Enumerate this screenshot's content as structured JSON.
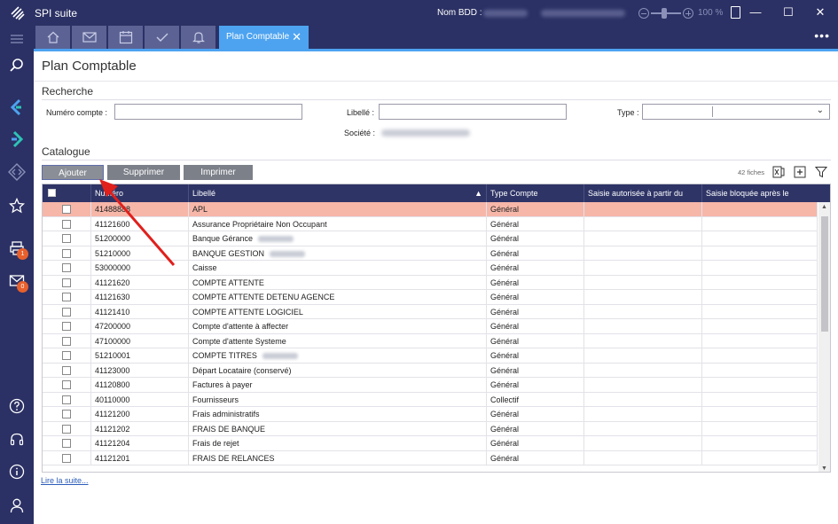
{
  "titlebar": {
    "app_name": "SPI suite",
    "db_label": "Nom BDD :",
    "zoom": "100 %",
    "minimize": "—",
    "maximize": "☐",
    "close": "✕"
  },
  "sidebar": {
    "badges": {
      "printer": "1",
      "mail": "0"
    }
  },
  "tabs": {
    "active_label": "Plan Comptable",
    "close_glyph": "✕",
    "more": "•••"
  },
  "page": {
    "title": "Plan Comptable"
  },
  "search": {
    "section_title": "Recherche",
    "numero_label": "Numéro compte :",
    "numero_value": "",
    "libelle_label": "Libellé :",
    "libelle_value": "",
    "type_label": "Type :",
    "type_value": "",
    "societe_label": "Société :"
  },
  "catalogue": {
    "section_title": "Catalogue",
    "buttons": {
      "add": "Ajouter",
      "delete": "Supprimer",
      "print": "Imprimer"
    },
    "count_text": "42 fiches",
    "columns": [
      "Numéro",
      "Libellé",
      "Type Compte",
      "Saisie autorisée à partir du",
      "Saisie bloquée après le"
    ],
    "sort_indicator": "▲",
    "rows": [
      {
        "numero": "41488888",
        "libelle": "APL",
        "type": "Général",
        "selected": true
      },
      {
        "numero": "41121600",
        "libelle": "Assurance Propriétaire Non Occupant",
        "type": "Général"
      },
      {
        "numero": "51200000",
        "libelle": "Banque Gérance",
        "type": "Général",
        "redacted": true
      },
      {
        "numero": "51210000",
        "libelle": "BANQUE GESTION",
        "type": "Général",
        "redacted": true
      },
      {
        "numero": "53000000",
        "libelle": "Caisse",
        "type": "Général"
      },
      {
        "numero": "41121620",
        "libelle": "COMPTE ATTENTE",
        "type": "Général"
      },
      {
        "numero": "41121630",
        "libelle": "COMPTE ATTENTE DETENU AGENCE",
        "type": "Général"
      },
      {
        "numero": "41121410",
        "libelle": "COMPTE ATTENTE LOGICIEL",
        "type": "Général"
      },
      {
        "numero": "47200000",
        "libelle": "Compte d'attente à affecter",
        "type": "Général"
      },
      {
        "numero": "47100000",
        "libelle": "Compte d'attente Systeme",
        "type": "Général"
      },
      {
        "numero": "51210001",
        "libelle": "COMPTE TITRES",
        "type": "Général",
        "redacted": true
      },
      {
        "numero": "41123000",
        "libelle": "Départ Locataire (conservé)",
        "type": "Général"
      },
      {
        "numero": "41120800",
        "libelle": "Factures à payer",
        "type": "Général"
      },
      {
        "numero": "40110000",
        "libelle": "Fournisseurs",
        "type": "Collectif"
      },
      {
        "numero": "41121200",
        "libelle": "Frais administratifs",
        "type": "Général"
      },
      {
        "numero": "41121202",
        "libelle": "FRAIS DE BANQUE",
        "type": "Général"
      },
      {
        "numero": "41121204",
        "libelle": "Frais de rejet",
        "type": "Général"
      },
      {
        "numero": "41121201",
        "libelle": "FRAIS DE RELANCES",
        "type": "Général"
      }
    ],
    "more_link": "Lire la suite..."
  },
  "colors": {
    "chrome": "#2b3164",
    "accent": "#4da3f0",
    "selected_row": "#f6b7a9",
    "badge": "#e8602c",
    "arrow": "#e0201c"
  }
}
